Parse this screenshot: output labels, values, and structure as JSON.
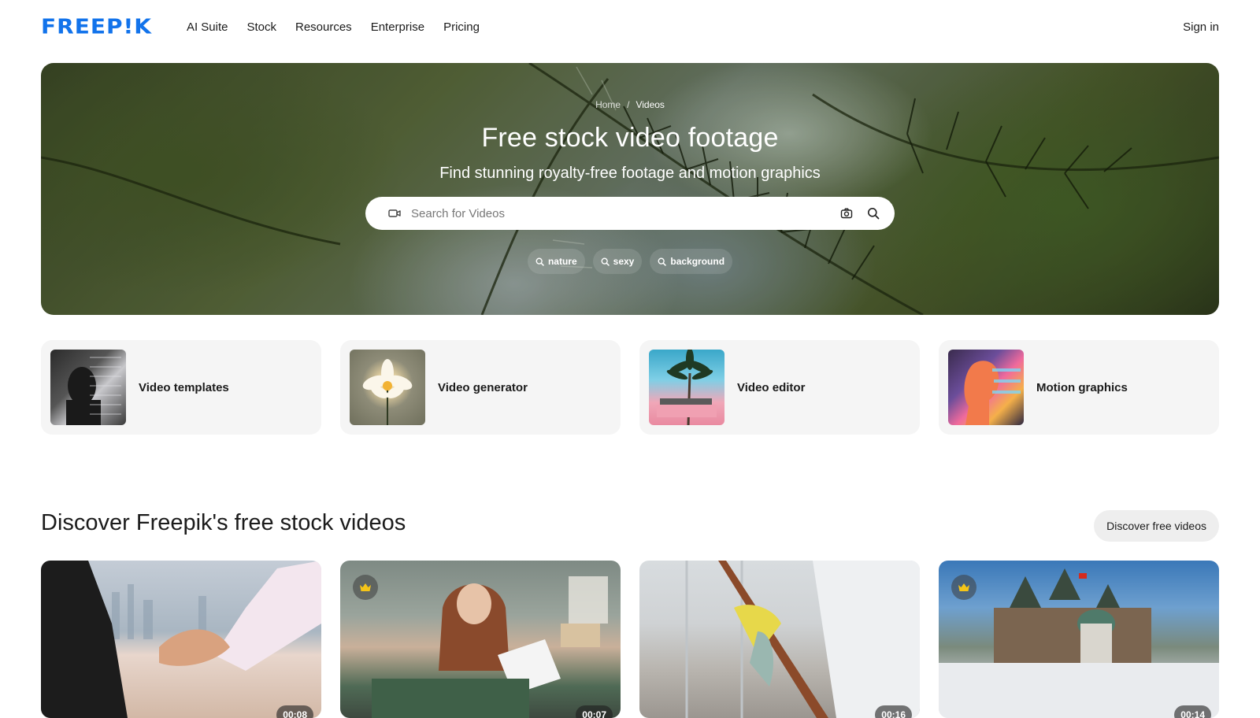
{
  "header": {
    "logo_text": "FREEP!K",
    "nav": [
      "AI Suite",
      "Stock",
      "Resources",
      "Enterprise",
      "Pricing"
    ],
    "signin_label": "Sign in",
    "brand_color": "#1273eb"
  },
  "hero": {
    "breadcrumb": {
      "home": "Home",
      "separator": "/",
      "current": "Videos"
    },
    "title": "Free stock video footage",
    "subtitle": "Find stunning royalty-free footage and motion graphics",
    "search": {
      "placeholder": "Search for Videos",
      "value": ""
    },
    "tags": [
      "nature",
      "sexy",
      "background"
    ]
  },
  "tools": [
    {
      "label": "Video templates"
    },
    {
      "label": "Video generator"
    },
    {
      "label": "Video editor"
    },
    {
      "label": "Motion graphics"
    }
  ],
  "discover": {
    "title": "Discover Freepik's free stock videos",
    "button_label": "Discover free videos"
  },
  "videos": [
    {
      "duration": "00:08",
      "premium": false
    },
    {
      "duration": "00:07",
      "premium": true
    },
    {
      "duration": "00:16",
      "premium": false
    },
    {
      "duration": "00:14",
      "premium": true
    }
  ],
  "icons": {
    "search_type": "video-camera-icon",
    "image_search": "camera-icon",
    "search": "search-icon",
    "tag_search": "search-icon",
    "premium": "crown-icon"
  },
  "colors": {
    "premium_crown": "#f5c518"
  }
}
